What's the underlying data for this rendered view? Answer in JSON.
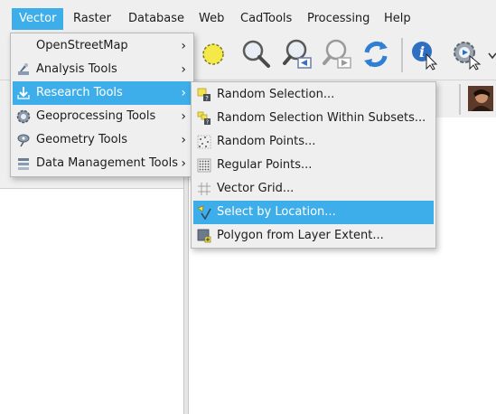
{
  "menubar": {
    "items": [
      {
        "label": "Vector"
      },
      {
        "label": "Raster"
      },
      {
        "label": "Database"
      },
      {
        "label": "Web"
      },
      {
        "label": "CadTools"
      },
      {
        "label": "Processing"
      },
      {
        "label": "Help"
      }
    ],
    "active_color": "#3daee9"
  },
  "vector_menu": {
    "items": [
      {
        "label": "OpenStreetMap",
        "icon": "none"
      },
      {
        "label": "Analysis Tools",
        "icon": "analysis-icon"
      },
      {
        "label": "Research Tools",
        "icon": "research-icon"
      },
      {
        "label": "Geoprocessing Tools",
        "icon": "geoprocessing-icon"
      },
      {
        "label": "Geometry Tools",
        "icon": "geometry-icon"
      },
      {
        "label": "Data Management Tools",
        "icon": "data-management-icon"
      }
    ],
    "submenu_arrow": "›"
  },
  "research_menu": {
    "items": [
      {
        "label": "Random Selection...",
        "icon": "random-selection-icon"
      },
      {
        "label": "Random Selection Within Subsets...",
        "icon": "random-subset-icon"
      },
      {
        "label": "Random Points...",
        "icon": "random-points-icon"
      },
      {
        "label": "Regular Points...",
        "icon": "regular-points-icon"
      },
      {
        "label": "Vector Grid...",
        "icon": "vector-grid-icon"
      },
      {
        "label": "Select by Location...",
        "icon": "select-location-icon"
      },
      {
        "label": "Polygon from Layer Extent...",
        "icon": "polygon-extent-icon"
      }
    ]
  },
  "toolbar": {
    "icons": [
      "pan-map-icon",
      "zoom-in-icon",
      "zoom-out-icon",
      "zoom-last-icon",
      "zoom-next-icon",
      "refresh-icon",
      "identify-icon",
      "run-action-icon"
    ]
  }
}
